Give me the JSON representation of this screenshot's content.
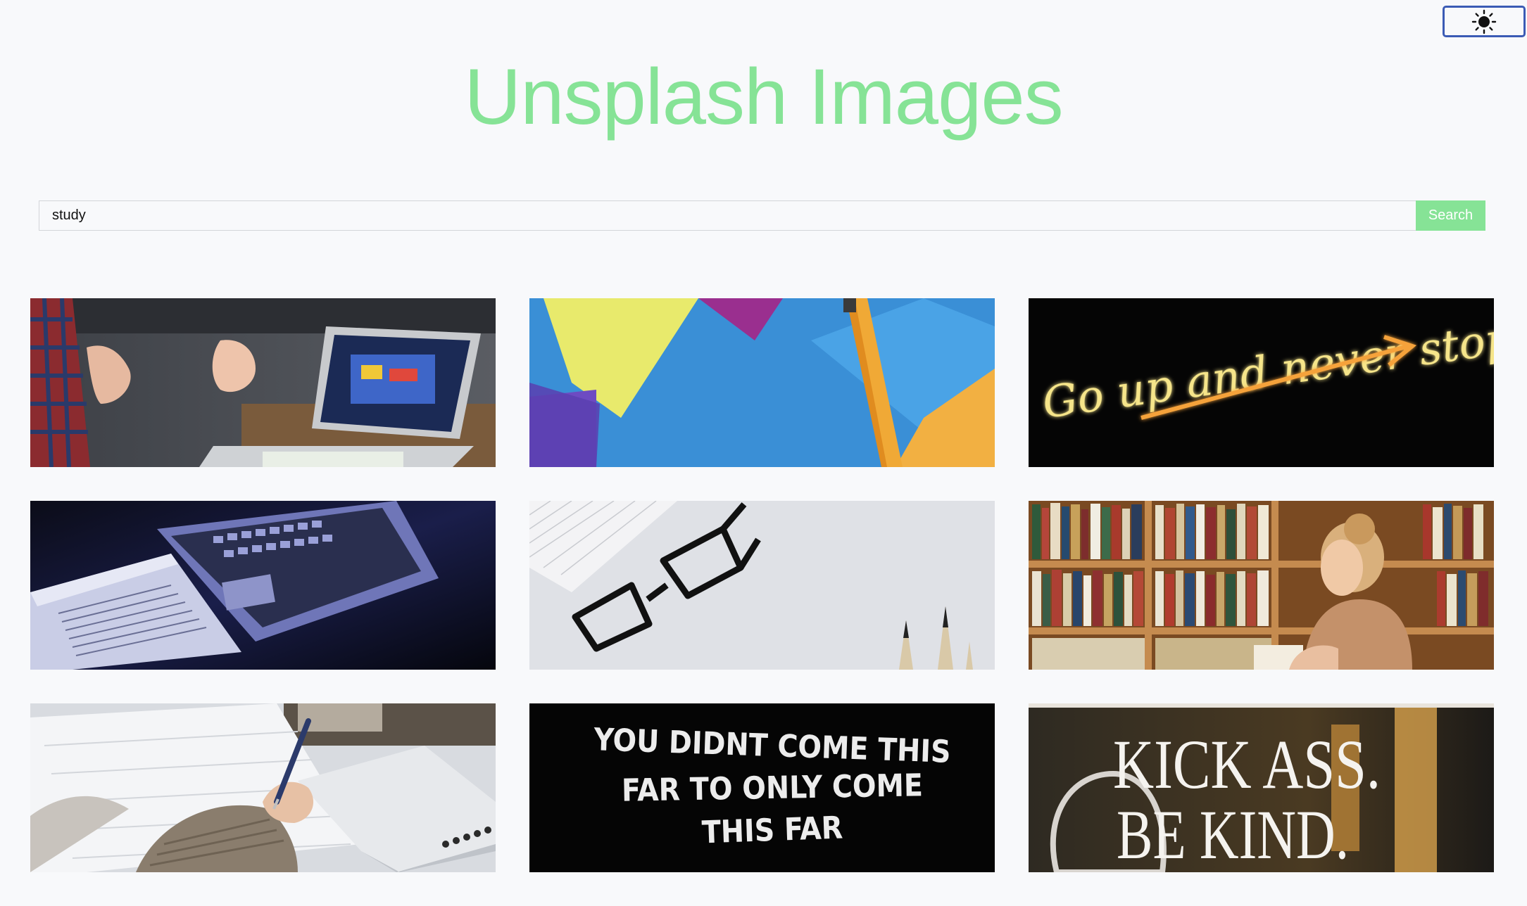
{
  "header": {
    "title": "Unsplash Images",
    "theme_toggle_icon": "sun-icon"
  },
  "search": {
    "value": "study",
    "placeholder": "",
    "button_label": "Search"
  },
  "gallery": {
    "images": [
      {
        "name": "laptop-meeting-photo"
      },
      {
        "name": "colorful-envelopes-pencil-photo"
      },
      {
        "name": "neon-sign-photo",
        "text": "Go up and never stop"
      },
      {
        "name": "dark-laptop-open-book-photo"
      },
      {
        "name": "eyeglasses-notebook-photo"
      },
      {
        "name": "woman-bookshelf-photo"
      },
      {
        "name": "hand-writing-notes-photo"
      },
      {
        "name": "letterboard-quote-photo",
        "lines": [
          "YOU DIDNT COME THIS",
          "FAR TO ONLY COME",
          "THIS FAR"
        ]
      },
      {
        "name": "window-quote-photo",
        "lines": [
          "KICK ASS.",
          "BE KIND."
        ]
      }
    ]
  },
  "colors": {
    "accent": "#86e396",
    "toggle_border": "#3b5bb5",
    "background": "#f8f9fb"
  }
}
